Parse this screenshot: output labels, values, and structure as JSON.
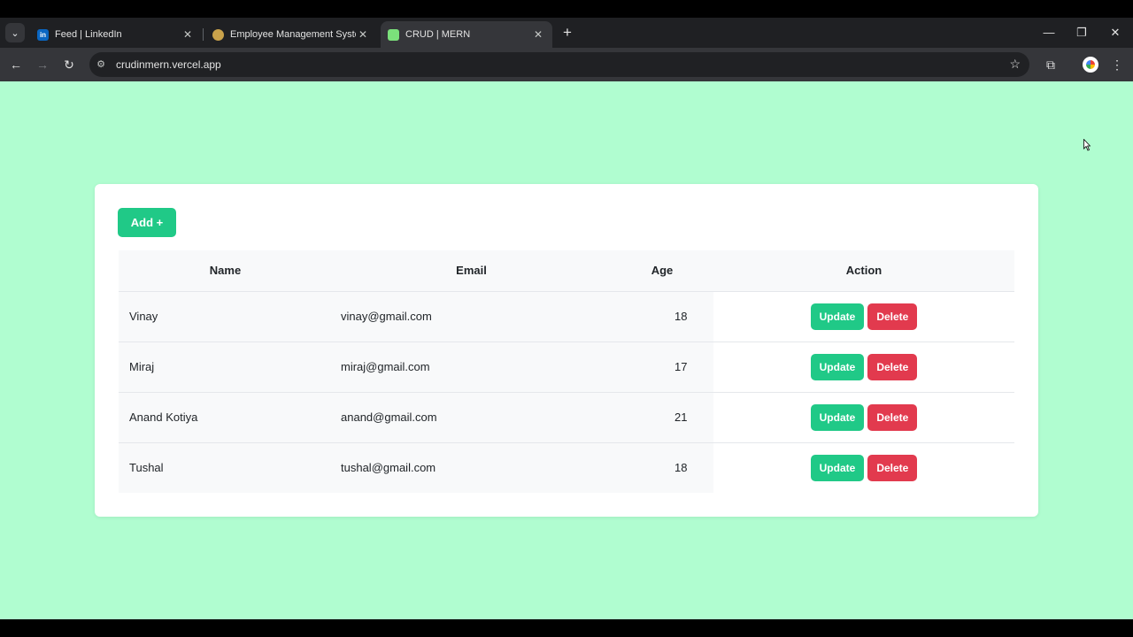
{
  "browser": {
    "tabs": [
      {
        "title": "Feed | LinkedIn",
        "favicon": "linkedin-icon",
        "active": false
      },
      {
        "title": "Employee Management System",
        "favicon": "user-icon",
        "active": false
      },
      {
        "title": "CRUD | MERN",
        "favicon": "green-square-icon",
        "active": true
      }
    ],
    "url": "crudinmern.vercel.app"
  },
  "colors": {
    "page_bg": "#b0fdd0",
    "primary_green": "#20c987",
    "danger_red": "#e23a4e"
  },
  "page": {
    "add_label": "Add +",
    "table": {
      "headers": [
        "Name",
        "Email",
        "Age",
        "Action"
      ],
      "rows": [
        {
          "name": "Vinay",
          "email": "vinay@gmail.com",
          "age": "18"
        },
        {
          "name": "Miraj",
          "email": "miraj@gmail.com",
          "age": "17"
        },
        {
          "name": "Anand Kotiya",
          "email": "anand@gmail.com",
          "age": "21"
        },
        {
          "name": "Tushal",
          "email": "tushal@gmail.com",
          "age": "18"
        }
      ]
    },
    "update_label": "Update",
    "delete_label": "Delete"
  }
}
